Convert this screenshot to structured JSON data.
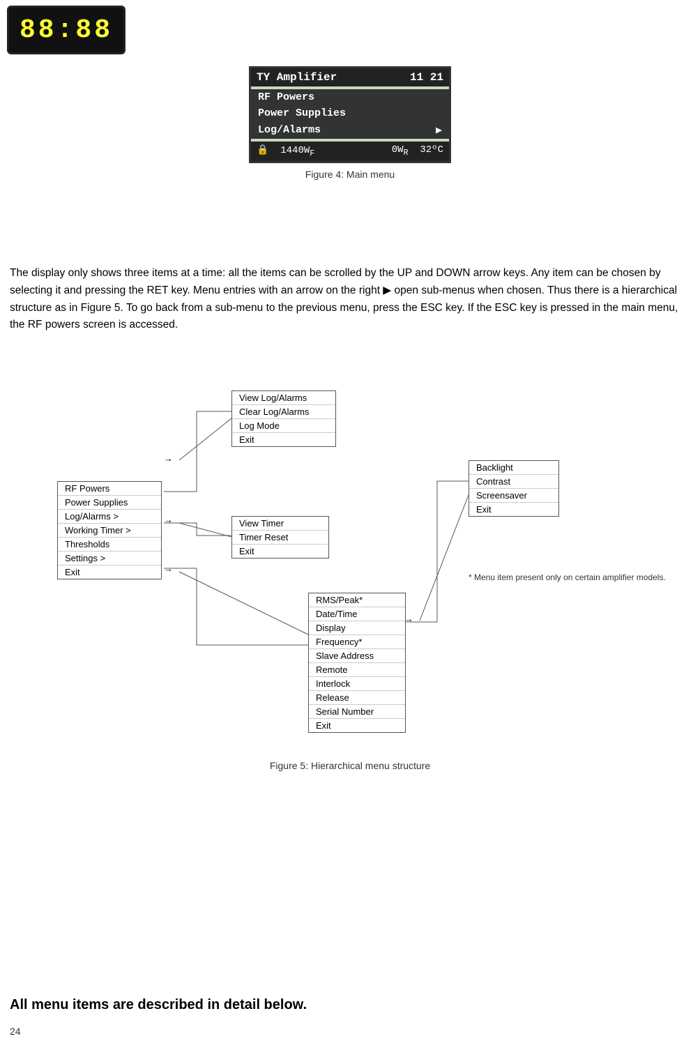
{
  "top_display": {
    "digits": "88:88"
  },
  "figure4": {
    "caption": "Figure 4: Main menu",
    "header_left": "TY  Amplifier",
    "header_right": "11 21",
    "rows": [
      {
        "text": "RF Powers",
        "selected": true
      },
      {
        "text": "Power  Supplies",
        "selected": true
      },
      {
        "text": "Log/Alarms ▶",
        "selected": true
      }
    ],
    "footer_left": "🔒  1440Wⁱ",
    "footer_right": "0Wᴷ  32ºC"
  },
  "body_text": "The display only shows three items at a time: all the items can be scrolled by the UP and DOWN arrow keys. Any item can be chosen by selecting it and pressing the RET key. Menu entries with an arrow on the right ▶ open sub-menus when chosen. Thus there is a hierarchical structure as in Figure 5. To go back from a sub-menu to the previous menu, press the ESC key. If the ESC key is pressed in the main menu, the RF powers screen is accessed.",
  "figure5": {
    "caption": "Figure 5: Hierarchical menu structure",
    "main_menu": {
      "items": [
        "RF Powers",
        "Power Supplies",
        "Log/Alarms >",
        "Working Timer >",
        "Thresholds",
        "Settings >",
        "Exit"
      ]
    },
    "log_alarms_menu": {
      "items": [
        "View Log/Alarms",
        "Clear Log/Alarms",
        "Log Mode",
        "Exit"
      ]
    },
    "working_timer_menu": {
      "items": [
        "View Timer",
        "Timer Reset",
        "Exit"
      ]
    },
    "settings_menu": {
      "items": [
        "RMS/Peak*",
        "Date/Time",
        "Display",
        "Frequency*",
        "Slave Address",
        "Remote",
        "Interlock",
        "Release",
        "Serial Number",
        "Exit"
      ]
    },
    "display_menu": {
      "items": [
        "Backlight",
        "Contrast",
        "Screensaver",
        "Exit"
      ]
    },
    "asterisk_note": "* Menu item present\nonly on certain amplifier\nmodels."
  },
  "bottom_text": "All menu items are described in detail below.",
  "page_number": "24"
}
